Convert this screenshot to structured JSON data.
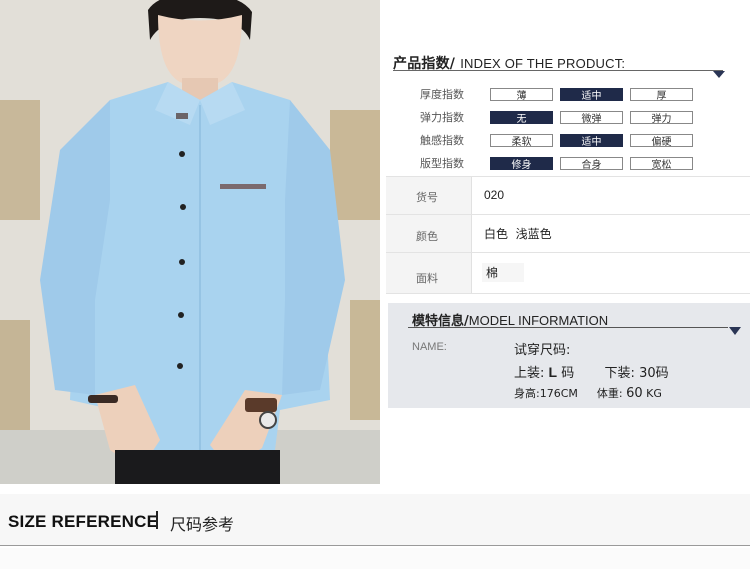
{
  "product_index": {
    "title_cn": "产品指数/",
    "title_en": "INDEX OF THE PRODUCT:",
    "rows": [
      {
        "label": "厚度指数",
        "options": [
          "薄",
          "适中",
          "厚"
        ],
        "selected": 1
      },
      {
        "label": "弹力指数",
        "options": [
          "无",
          "微弹",
          "弹力"
        ],
        "selected": 0
      },
      {
        "label": "触感指数",
        "options": [
          "柔软",
          "适中",
          "偏硬"
        ],
        "selected": 1
      },
      {
        "label": "版型指数",
        "options": [
          "修身",
          "合身",
          "宽松"
        ],
        "selected": 0
      }
    ]
  },
  "spec": {
    "rows": [
      {
        "key": "货号",
        "value": "020"
      },
      {
        "key": "颜色",
        "value": "白色  浅蓝色"
      },
      {
        "key": "面料",
        "value": "棉"
      }
    ]
  },
  "model_info": {
    "title_cn": "模特信息/",
    "title_en": "MODEL INFORMATION",
    "name_label": "NAME:",
    "try_size": "试穿尺码:",
    "top_label": "上装:",
    "top_size": "L",
    "top_unit": "码",
    "bottom_label": "下装:",
    "bottom_size": "30码",
    "height": "身高:176CM",
    "weight_label": "体重:",
    "weight_value": "60",
    "weight_unit": "KG"
  },
  "size_reference": {
    "en": "SIZE REFERENCE",
    "cn": "尺码参考"
  },
  "colors": {
    "selected_fill": "#1f2a49",
    "shirt": "#a9d3ef",
    "model_bg": "#e6e8ec"
  }
}
